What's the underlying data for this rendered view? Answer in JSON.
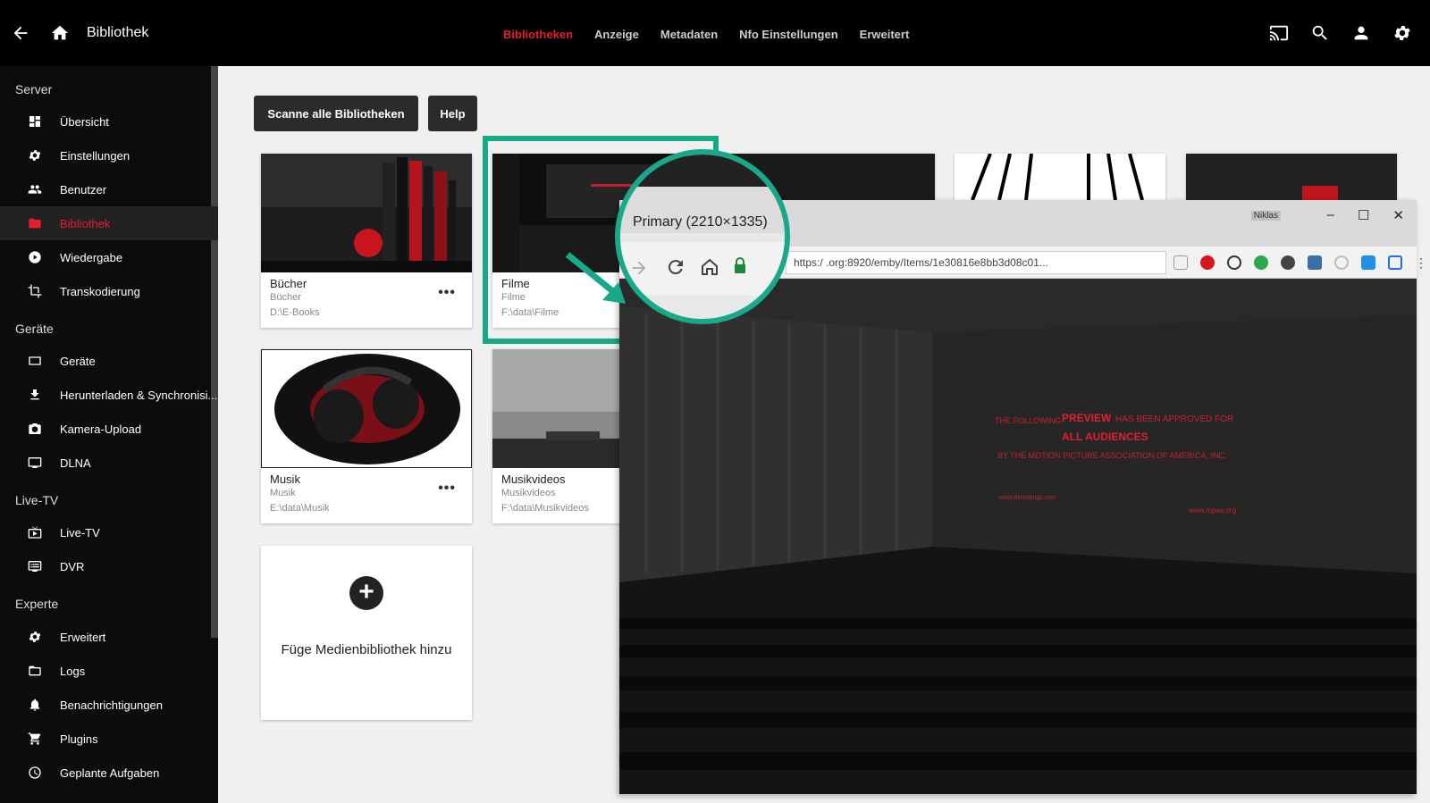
{
  "topbar": {
    "title": "Bibliothek",
    "nav": [
      "Bibliotheken",
      "Anzeige",
      "Metadaten",
      "Nfo Einstellungen",
      "Erweitert"
    ]
  },
  "sidebar": {
    "sections": {
      "server": "Server",
      "geraete": "Geräte",
      "livetv": "Live-TV",
      "experte": "Experte"
    },
    "items": [
      {
        "label": "Übersicht",
        "icon": "dashboard-icon"
      },
      {
        "label": "Einstellungen",
        "icon": "gear-icon"
      },
      {
        "label": "Benutzer",
        "icon": "people-icon"
      },
      {
        "label": "Bibliothek",
        "icon": "folder-icon"
      },
      {
        "label": "Wiedergabe",
        "icon": "play-icon"
      },
      {
        "label": "Transkodierung",
        "icon": "crop-icon"
      },
      {
        "label": "Geräte",
        "icon": "device-icon"
      },
      {
        "label": "Herunterladen & Synchronisi...",
        "icon": "download-icon"
      },
      {
        "label": "Kamera-Upload",
        "icon": "camera-icon"
      },
      {
        "label": "DLNA",
        "icon": "dlna-icon"
      },
      {
        "label": "Live-TV",
        "icon": "livetv-icon"
      },
      {
        "label": "DVR",
        "icon": "dvr-icon"
      },
      {
        "label": "Erweitert",
        "icon": "gear-icon"
      },
      {
        "label": "Logs",
        "icon": "folder-open-icon"
      },
      {
        "label": "Benachrichtigungen",
        "icon": "bell-icon"
      },
      {
        "label": "Plugins",
        "icon": "cart-icon"
      },
      {
        "label": "Geplante Aufgaben",
        "icon": "clock-icon"
      }
    ]
  },
  "main": {
    "scan_button": "Scanne alle Bibliotheken",
    "help_button": "Help",
    "libraries": [
      {
        "name": "Bücher",
        "type": "Bücher",
        "path": "D:\\E-Books"
      },
      {
        "name": "Filme",
        "type": "Filme",
        "path": "F:\\data\\Filme"
      },
      {
        "name": "Musik",
        "type": "Musik",
        "path": "E:\\data\\Musik"
      },
      {
        "name": "Musikvideos",
        "type": "Musikvideos",
        "path": "F:\\data\\Musikvideos"
      }
    ],
    "more_label": "•••",
    "add_library": "Füge Medienbibliothek hinzu"
  },
  "overlay": {
    "tab_label": "Primary (2210×1335)",
    "url": "https:/           .org:8920/emby/Items/1e30816e8bb3d08c01...",
    "user_label": "Niklas",
    "screen_text": {
      "line1a": "THE FOLLOWING",
      "line1b": "PREVIEW",
      "line1c": "HAS BEEN APPROVED FOR",
      "line2": "ALL AUDIENCES",
      "line3": "BY THE MOTION PICTURE ASSOCIATION OF AMERICA, INC.",
      "site_left": "www.filmratings.com",
      "site_right": "www.mpaa.org"
    }
  },
  "colors": {
    "accent": "#e0202e",
    "highlight": "#18a88a"
  }
}
